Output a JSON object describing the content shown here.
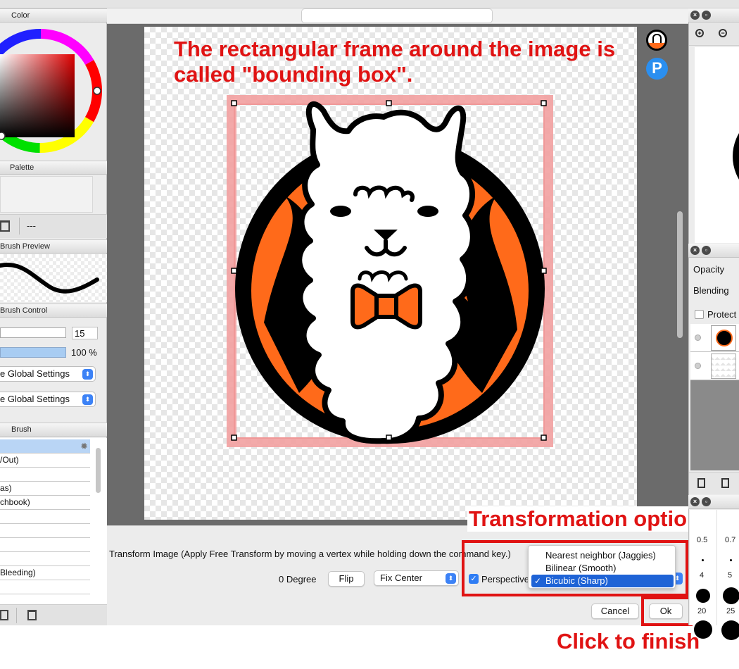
{
  "left_panel": {
    "color_header": "Color",
    "palette_header": "Palette",
    "palette_value": "---",
    "brush_preview_header": "Brush Preview",
    "brush_control_header": "Brush Control",
    "brush_size_value": "15",
    "opacity_value": "100 %",
    "global_settings_1": "e Global Settings",
    "global_settings_2": "e Global Settings",
    "brush_header": "Brush",
    "brush_items": [
      "",
      "/Out)",
      "",
      "as)",
      "chbook)",
      "",
      "",
      "",
      "Bleeding)",
      "",
      ""
    ]
  },
  "canvas": {
    "annotation_title_line1": "The rectangular frame around the image is",
    "annotation_title_line2": "called \"bounding box\"."
  },
  "transform_bar": {
    "instruction": "Transform Image (Apply Free Transform by moving a vertex while holding down the command key.)",
    "degree_label": "0 Degree",
    "flip_label": "Flip",
    "fix_center_value": "Fix Center",
    "perspective_label": "Perspective",
    "interpolation_options": [
      "Nearest neighbor (Jaggies)",
      "Bilinear (Smooth)",
      "Bicubic (Sharp)"
    ],
    "interpolation_selected": "Bicubic (Sharp)",
    "cancel_label": "Cancel",
    "ok_label": "Ok",
    "annotation_option": "Transformation option",
    "annotation_finish": "Click to finish"
  },
  "right_panel": {
    "opacity_label": "Opacity",
    "blending_label": "Blending",
    "protect_label": "Protect",
    "brush_sizes": [
      "0.5",
      "0.7",
      "4",
      "5",
      "20",
      "25"
    ]
  },
  "colors": {
    "accent_red": "#e01313",
    "select_blue": "#1e63d6",
    "alpaca_orange": "#ff6a1a"
  }
}
